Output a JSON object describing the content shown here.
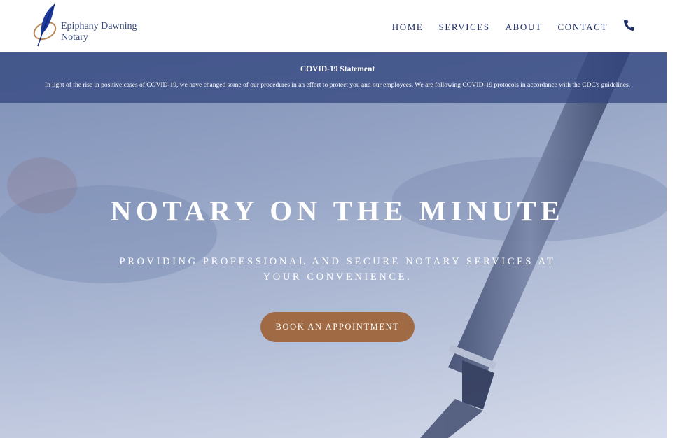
{
  "brand": {
    "name_line1": "Epiphany Dawning",
    "name_line2": "Notary",
    "logo_icon": "quill-feather-icon",
    "colors": {
      "navy": "#1f2f66",
      "gold": "#b8875a"
    }
  },
  "nav": {
    "items": [
      {
        "label": "HOME"
      },
      {
        "label": "SERVICES"
      },
      {
        "label": "ABOUT"
      },
      {
        "label": "CONTACT"
      }
    ],
    "phone_icon": "phone-icon"
  },
  "covid": {
    "title": "COVID-19 Statement",
    "text": "In light of the rise in positive cases of COVID-19, we have changed some of our procedures in an effort to protect you and our employees. We are following COVID-19 protocols in accordance with the CDC's guidelines."
  },
  "hero": {
    "title": "NOTARY ON THE MINUTE",
    "subtitle": "PROVIDING PROFESSIONAL AND SECURE NOTARY SERVICES AT YOUR CONVENIENCE.",
    "cta_label": "BOOK AN APPOINTMENT",
    "colors": {
      "cta": "#a06b44",
      "overlay": "#344880"
    }
  }
}
